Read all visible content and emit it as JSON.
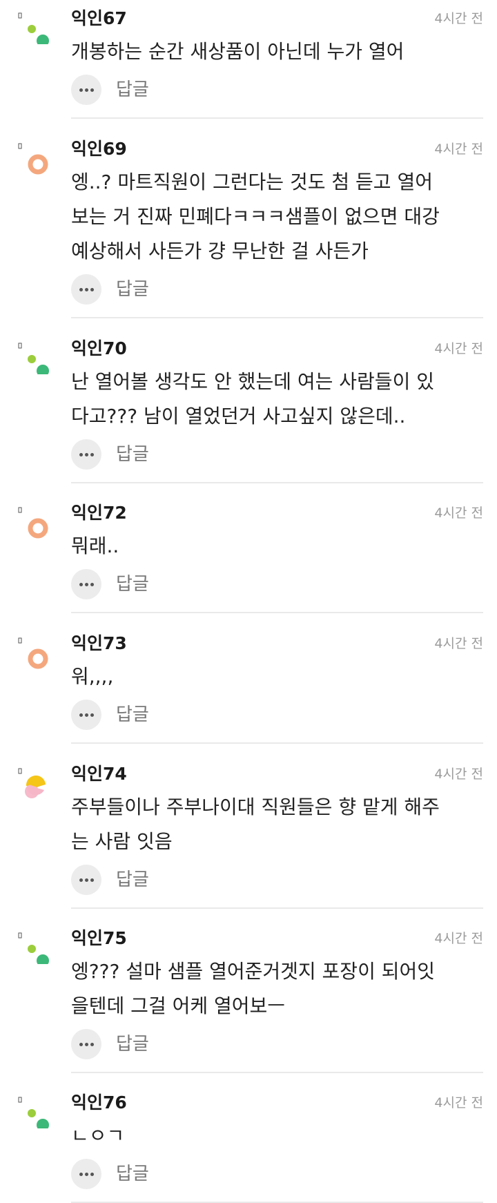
{
  "colors": {
    "dot_green_light": "#9ccd3c",
    "dot_green": "#3cb878",
    "avatar_orange_ring": "#f4a77d",
    "avatar_yellow": "#f5c518",
    "avatar_pink": "#f6b6c8",
    "divider": "#e9e9e9",
    "meta_gray": "#9a9a9a"
  },
  "comments": [
    {
      "author": "익인67",
      "time": "4시간 전",
      "avatar": "two-dots",
      "lines": [
        "개봉하는 순간 새상품이 아닌데 누가 열어"
      ],
      "more_icon": "ellipsis-icon",
      "reply_label": "답글"
    },
    {
      "author": "익인69",
      "time": "4시간 전",
      "avatar": "orange-ring",
      "lines": [
        "엥..? 마트직원이 그런다는 것도 첨 듣고 열어",
        "보는 거 진짜 민폐다ㅋㅋㅋ샘플이 없으면 대강",
        "예상해서 사든가 걍 무난한 걸 사든가"
      ],
      "more_icon": "ellipsis-icon",
      "reply_label": "답글"
    },
    {
      "author": "익인70",
      "time": "4시간 전",
      "avatar": "two-dots",
      "lines": [
        "난 열어볼 생각도 안 했는데 여는 사람들이 있",
        "다고??? 남이 열었던거 사고싶지 않은데.."
      ],
      "more_icon": "ellipsis-icon",
      "reply_label": "답글"
    },
    {
      "author": "익인72",
      "time": "4시간 전",
      "avatar": "orange-ring",
      "lines": [
        "뭐래.."
      ],
      "more_icon": "ellipsis-icon",
      "reply_label": "답글"
    },
    {
      "author": "익인73",
      "time": "4시간 전",
      "avatar": "orange-ring",
      "lines": [
        "워,,,,"
      ],
      "more_icon": "ellipsis-icon",
      "reply_label": "답글"
    },
    {
      "author": "익인74",
      "time": "4시간 전",
      "avatar": "yellow-pink",
      "lines": [
        "주부들이나 주부나이대 직원들은 향 맡게 해주",
        "는 사람 잇음"
      ],
      "more_icon": "ellipsis-icon",
      "reply_label": "답글"
    },
    {
      "author": "익인75",
      "time": "4시간 전",
      "avatar": "two-dots",
      "lines": [
        "엥??? 설마 샘플 열어준거겟지 포장이 되어잇",
        "을텐데 그걸 어케 열어보ㅡ"
      ],
      "more_icon": "ellipsis-icon",
      "reply_label": "답글"
    },
    {
      "author": "익인76",
      "time": "4시간 전",
      "avatar": "two-dots",
      "lines": [
        "ㄴㅇㄱ"
      ],
      "more_icon": "ellipsis-icon",
      "reply_label": "답글"
    }
  ]
}
